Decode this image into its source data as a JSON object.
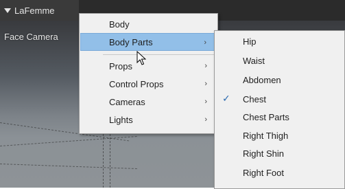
{
  "figure": {
    "name": "LaFemme",
    "camera": "Face Camera"
  },
  "main_menu": {
    "items": [
      {
        "label": "Body",
        "submenu": false,
        "highlighted": false
      },
      {
        "label": "Body Parts",
        "submenu": true,
        "highlighted": true
      },
      {
        "label": "Props",
        "submenu": true,
        "highlighted": false
      },
      {
        "label": "Control Props",
        "submenu": true,
        "highlighted": false
      },
      {
        "label": "Cameras",
        "submenu": true,
        "highlighted": false
      },
      {
        "label": "Lights",
        "submenu": true,
        "highlighted": false
      }
    ],
    "arrow_glyph": "›"
  },
  "body_parts_menu": {
    "items": [
      {
        "label": "Hip",
        "checked": false
      },
      {
        "label": "Waist",
        "checked": false
      },
      {
        "label": "Abdomen",
        "checked": false
      },
      {
        "label": "Chest",
        "checked": true
      },
      {
        "label": "Chest Parts",
        "checked": false
      },
      {
        "label": "Right Thigh",
        "checked": false
      },
      {
        "label": "Right Shin",
        "checked": false
      },
      {
        "label": "Right Foot",
        "checked": false
      }
    ],
    "check_glyph": "✓"
  },
  "colors": {
    "highlight": "#92bfe8",
    "menu_bg": "#f0f0f0",
    "check": "#2a6ab0"
  }
}
